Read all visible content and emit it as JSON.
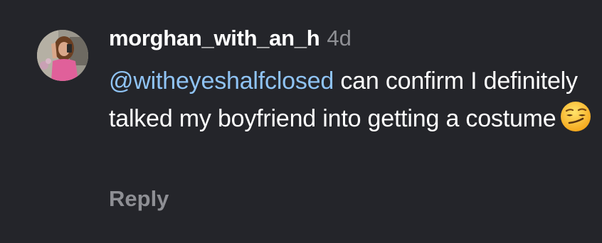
{
  "comment": {
    "username": "morghan_with_an_h",
    "time_ago": "4d",
    "mention": "@witheyeshalfclosed",
    "text_after_mention": " can confirm I definitely talked my boyfriend into getting a costume",
    "emoji_icon": "smirking-face-emoji",
    "reply_label": "Reply"
  },
  "colors": {
    "background": "#24252a",
    "mention": "#8fc3f4",
    "muted": "#8e8f94",
    "text": "#ffffff"
  }
}
